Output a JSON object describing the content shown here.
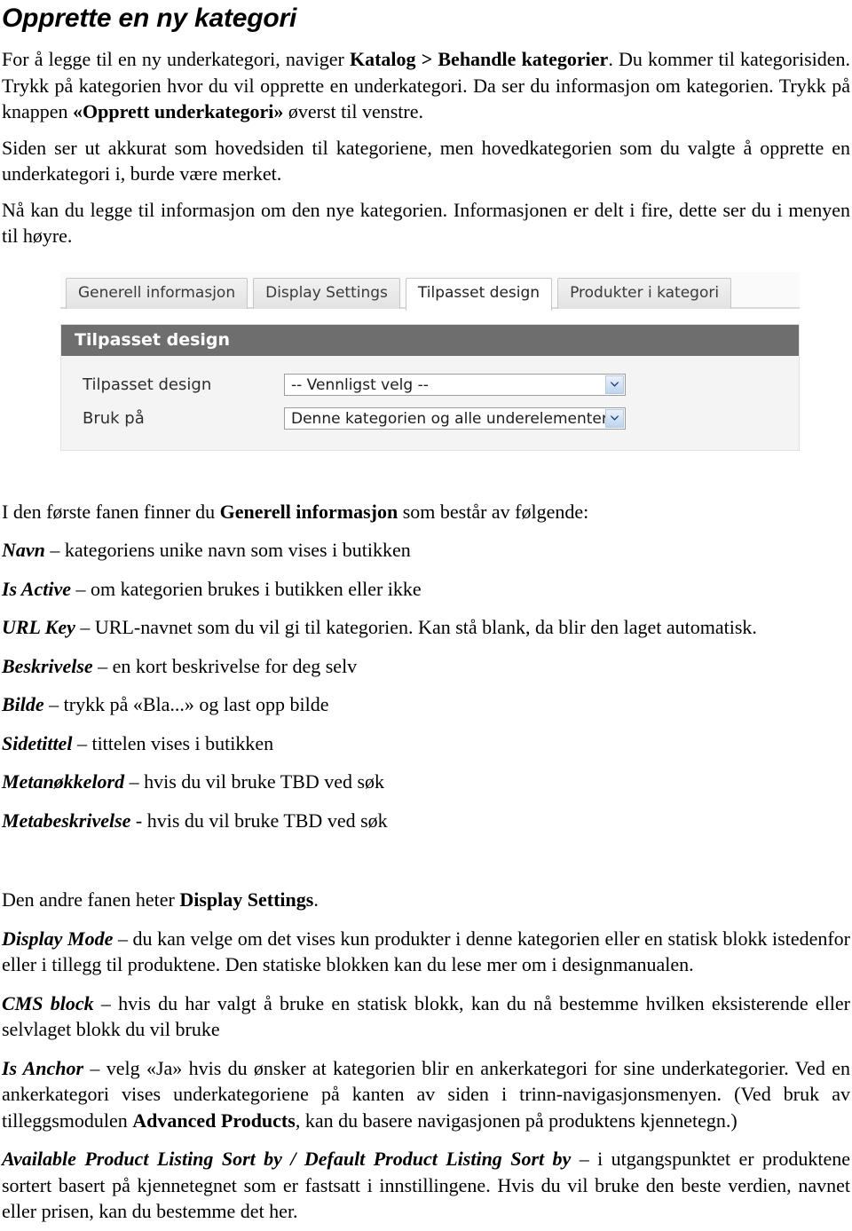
{
  "document": {
    "title": "Opprette en ny kategori",
    "paragraphs": {
      "intro_1a": "For å legge til en ny underkategori, naviger ",
      "intro_1b": "Katalog > Behandle kategorier",
      "intro_1c": ". Du kommer til kategorisiden. Trykk på kategorien hvor du vil opprette en underkategori. Da ser du informasjon om kategorien. Trykk på knappen ",
      "intro_1d": "«Opprett underkategori»",
      "intro_1e": " øverst til venstre.",
      "intro_2": "Siden ser ut akkurat som hovedsiden til kategoriene, men hovedkategorien som du valgte å opprette en underkategori i, burde være merket.",
      "intro_3": "Nå kan du legge til informasjon om den nye kategorien. Informasjonen er delt i fire, dette ser du i menyen til høyre.",
      "first_tab_a": "I den første fanen finner du ",
      "first_tab_b": "Generell informasjon",
      "first_tab_c": " som består av følgende:",
      "second_tab_a": "Den andre fanen heter ",
      "second_tab_b": "Display Settings",
      "second_tab_c": "."
    },
    "general_info_items": [
      {
        "term": "Navn",
        "desc": " – kategoriens unike navn som vises i butikken"
      },
      {
        "term": "Is Active",
        "desc": " – om kategorien brukes i butikken eller ikke"
      },
      {
        "term": "URL Key",
        "desc": " – URL-navnet som du vil gi til kategorien. Kan stå blank, da blir den laget automatisk."
      },
      {
        "term": "Beskrivelse",
        "desc": " – en kort beskrivelse for deg selv"
      },
      {
        "term": "Bilde",
        "desc": " – trykk på «Bla...» og last opp bilde"
      },
      {
        "term": "Sidetittel",
        "desc": " – tittelen vises i butikken"
      },
      {
        "term": "Metanøkkelord",
        "desc": " – hvis du vil bruke TBD ved søk"
      },
      {
        "term": "Metabeskrivelse",
        "desc": " - hvis du vil bruke TBD ved søk"
      }
    ],
    "display_settings_items": {
      "display_mode": {
        "term": "Display Mode",
        "desc": " – du kan velge om det vises kun produkter i denne kategorien eller en statisk blokk istedenfor eller i tillegg til produktene. Den statiske blokken kan du lese mer om i designmanualen."
      },
      "cms_block": {
        "term": "CMS block",
        "desc": " – hvis du har valgt å bruke en statisk blokk, kan du nå bestemme hvilken eksisterende eller selvlaget blokk du vil bruke"
      },
      "is_anchor": {
        "term": "Is Anchor",
        "desc_a": " – velg «Ja» hvis du ønsker at kategorien blir en ankerkategori for sine underkategorier. Ved en ankerkategori vises underkategoriene på kanten av siden i trinn-navigasjonsmenyen. (Ved bruk av tilleggsmodulen ",
        "bold": "Advanced Products",
        "desc_b": ", kan du basere navigasjonen på produktens kjennetegn.)"
      },
      "sort_by": {
        "term": "Available Product Listing Sort by / Default Product Listing Sort by",
        "desc": " – i utgangspunktet er produktene sortert basert på kjennetegnet som er fastsatt i innstillingene. Hvis du vil bruke den beste verdien, navnet eller prisen, kan du bestemme det her."
      }
    }
  },
  "screenshot": {
    "tabs": [
      {
        "label": "Generell informasjon",
        "active": false
      },
      {
        "label": "Display Settings",
        "active": false
      },
      {
        "label": "Tilpasset design",
        "active": true
      },
      {
        "label": "Produkter i kategori",
        "active": false
      }
    ],
    "panel_heading": "Tilpasset design",
    "fields": [
      {
        "label": "Tilpasset design",
        "value": "-- Vennligst velg --"
      },
      {
        "label": "Bruk på",
        "value": "Denne kategorien og alle underelementer"
      }
    ],
    "colors": {
      "panel_header_bg": "#6e6e6e",
      "panel_bg": "#f4f4f4",
      "active_tab_bg": "#ffffff",
      "tab_bg": "#e9e9e9",
      "select_arrow_bg": "#bdd4f0"
    }
  }
}
